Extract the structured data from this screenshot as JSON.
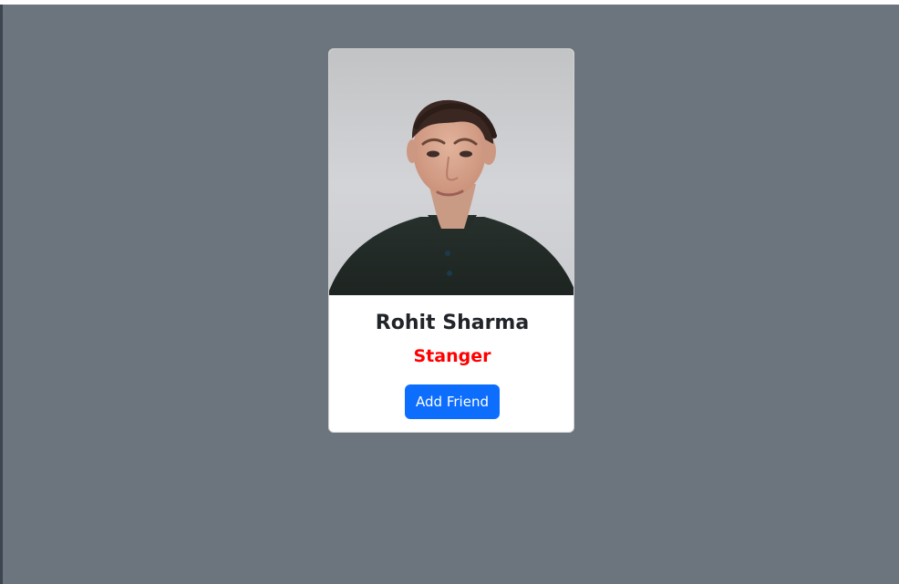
{
  "profile_card": {
    "name": "Rohit Sharma",
    "status": "Stanger",
    "button_label": "Add Friend"
  },
  "colors": {
    "page_background": "#6c757d",
    "card_background": "#ffffff",
    "name_text": "#212529",
    "status_text": "#ff0000",
    "button_background": "#0d6efd",
    "button_text": "#ffffff"
  }
}
